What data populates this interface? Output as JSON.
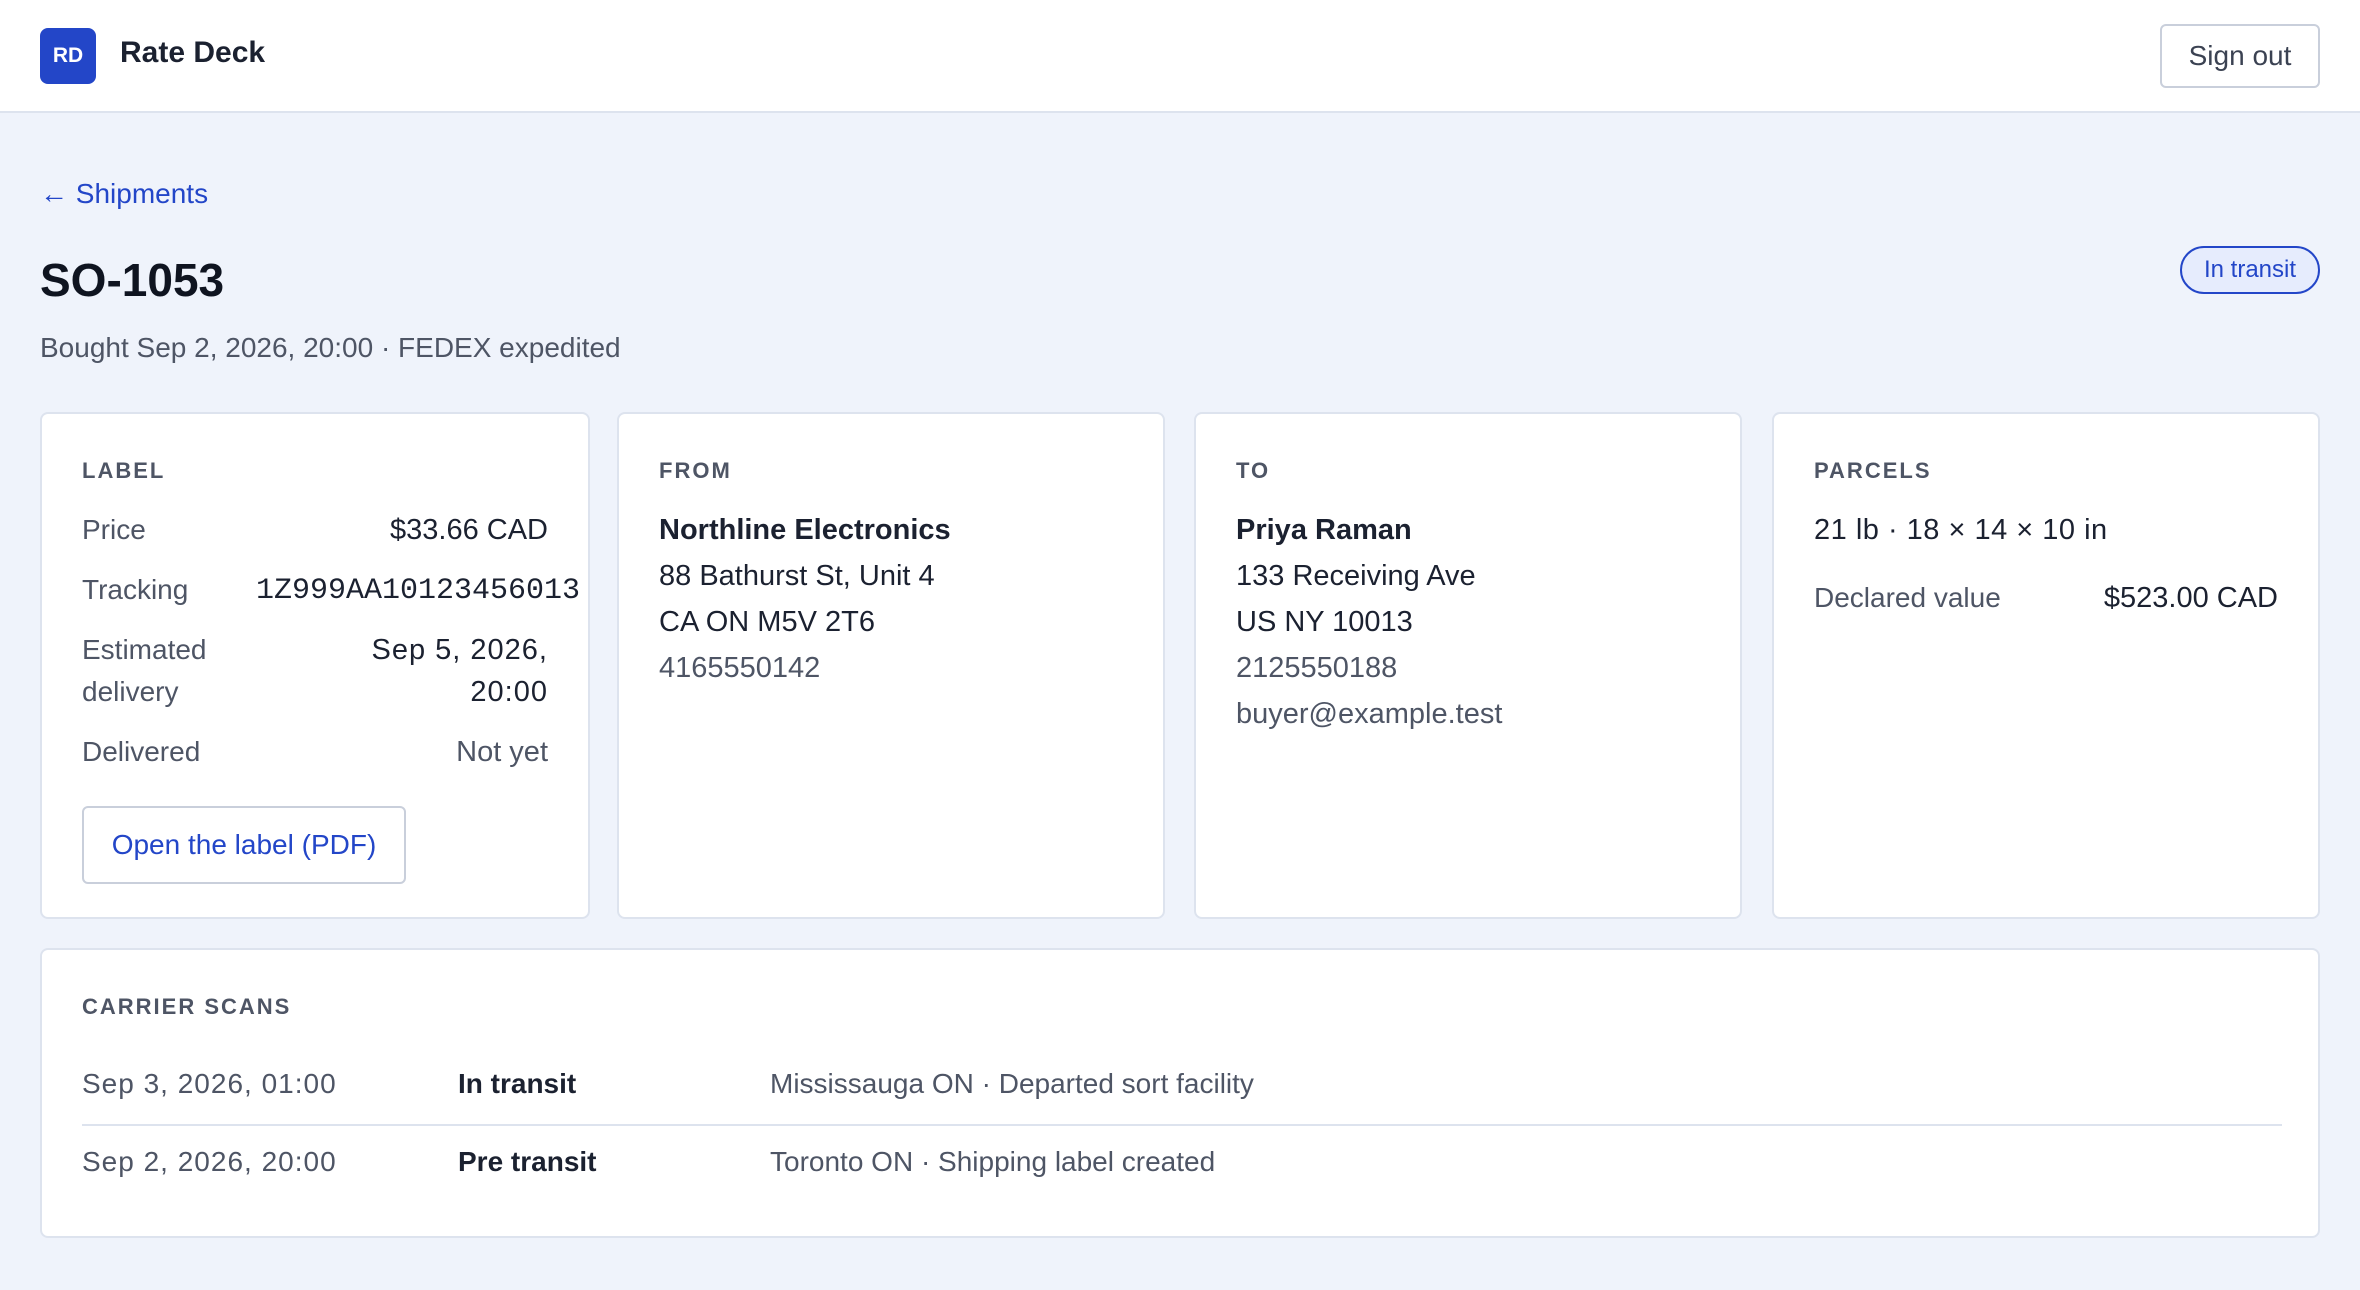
{
  "app": {
    "logo_initials": "RD",
    "name": "Rate Deck",
    "sign_out": "Sign out"
  },
  "nav": {
    "back_arrow": "←",
    "back_label": "Shipments"
  },
  "shipment": {
    "id": "SO-1053",
    "subtitle": "Bought Sep 2, 2026, 20:00 · FEDEX expedited",
    "status": "In transit"
  },
  "label_card": {
    "heading": "LABEL",
    "price_label": "Price",
    "price_value": "$33.66 CAD",
    "tracking_label": "Tracking",
    "tracking_value": "1Z999AA10123456013",
    "eta_label_1": "Estimated",
    "eta_label_2": "delivery",
    "eta_value_1": "Sep 5, 2026,",
    "eta_value_2": "20:00",
    "delivered_label": "Delivered",
    "delivered_value": "Not yet",
    "open_button": "Open the label (PDF)"
  },
  "from_card": {
    "heading": "FROM",
    "name": "Northline Electronics",
    "street": "88 Bathurst St, Unit 4",
    "region": "CA ON M5V 2T6",
    "phone": "4165550142"
  },
  "to_card": {
    "heading": "TO",
    "name": "Priya Raman",
    "street": "133 Receiving Ave",
    "region": "US NY 10013",
    "phone": "2125550188",
    "email": "buyer@example.test"
  },
  "parcels_card": {
    "heading": "PARCELS",
    "summary": "21 lb · 18 × 14 × 10 in",
    "declared_label": "Declared value",
    "declared_value": "$523.00 CAD"
  },
  "scans": {
    "heading": "CARRIER SCANS",
    "rows": [
      {
        "date": "Sep 3, 2026, 01:00",
        "status": "In transit",
        "desc": "Mississauga ON · Departed sort facility"
      },
      {
        "date": "Sep 2, 2026, 20:00",
        "status": "Pre transit",
        "desc": "Toronto ON · Shipping label created"
      }
    ]
  },
  "colors": {
    "accent": "#2346c8",
    "background": "#eff3fb",
    "card": "#ffffff",
    "border": "#dde3ee"
  }
}
